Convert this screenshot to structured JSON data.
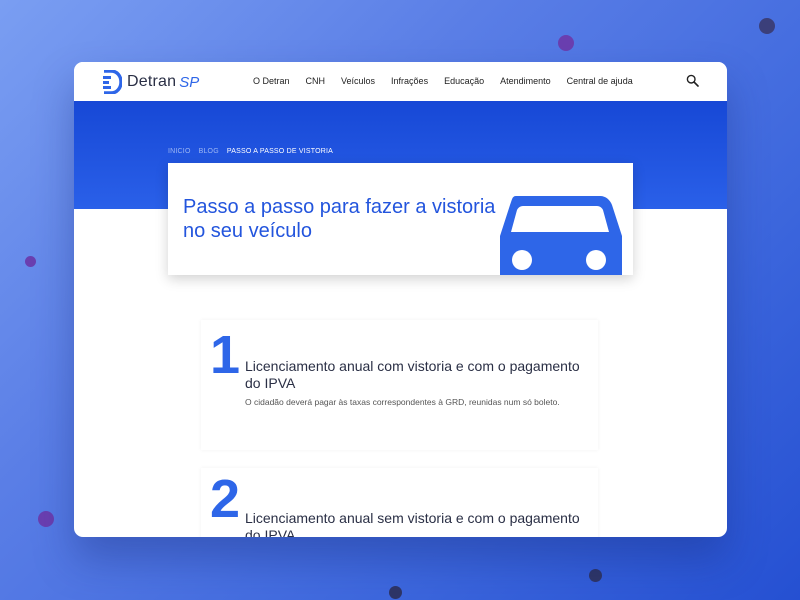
{
  "brand": {
    "name": "Detran",
    "suffix": "SP"
  },
  "nav": {
    "items": [
      "O Detran",
      "CNH",
      "Veículos",
      "Infrações",
      "Educação",
      "Atendimento",
      "Central de ajuda"
    ]
  },
  "breadcrumb": {
    "items": [
      "INICIO",
      "BLOG"
    ],
    "current": "PASSO A PASSO DE VISTORIA"
  },
  "hero": {
    "title": "Passo a passo para fazer a vistoria no seu veículo"
  },
  "steps": [
    {
      "number": "1",
      "title": "Licenciamento anual com vistoria e com o pagamento do IPVA",
      "description": "O cidadão deverá pagar às taxas correspondentes à GRD, reunidas num só boleto."
    },
    {
      "number": "2",
      "title": "Licenciamento anual sem vistoria e com o pagamento do IPVA",
      "description": ""
    }
  ],
  "icons": {
    "logo": "detran-logo-icon",
    "search": "search-icon",
    "car": "car-icon"
  },
  "colors": {
    "primary": "#2e66e8",
    "hero": "#1748d6",
    "text": "#2a2f45"
  }
}
